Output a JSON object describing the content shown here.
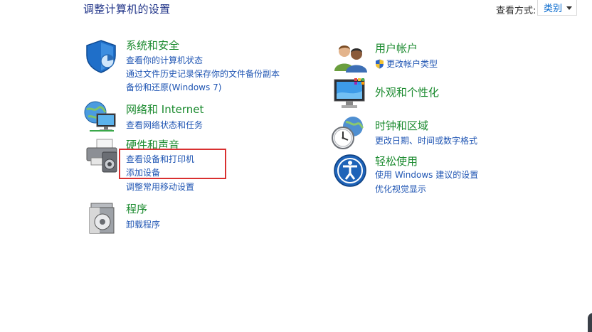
{
  "header": {
    "title": "调整计算机的设置",
    "view_by_label": "查看方式:",
    "view_by_value": "类别"
  },
  "categories": {
    "system": {
      "title": "系统和安全",
      "links": [
        "查看你的计算机状态",
        "通过文件历史记录保存你的文件备份副本",
        "备份和还原(Windows 7)"
      ]
    },
    "network": {
      "title": "网络和 Internet",
      "links": [
        "查看网络状态和任务"
      ]
    },
    "hardware": {
      "title": "硬件和声音",
      "links": [
        "查看设备和打印机",
        "添加设备",
        "调整常用移动设置"
      ]
    },
    "programs": {
      "title": "程序",
      "links": [
        "卸载程序"
      ]
    },
    "accounts": {
      "title": "用户帐户",
      "links": [
        "更改帐户类型"
      ]
    },
    "appearance": {
      "title": "外观和个性化",
      "links": []
    },
    "clock": {
      "title": "时钟和区域",
      "links": [
        "更改日期、时间或数字格式"
      ]
    },
    "ease": {
      "title": "轻松使用",
      "links": [
        "使用 Windows 建议的设置",
        "优化视觉显示"
      ]
    }
  },
  "colors": {
    "category_title": "#1a8a2e",
    "link": "#1f55b3",
    "highlight_box": "#d93030"
  }
}
